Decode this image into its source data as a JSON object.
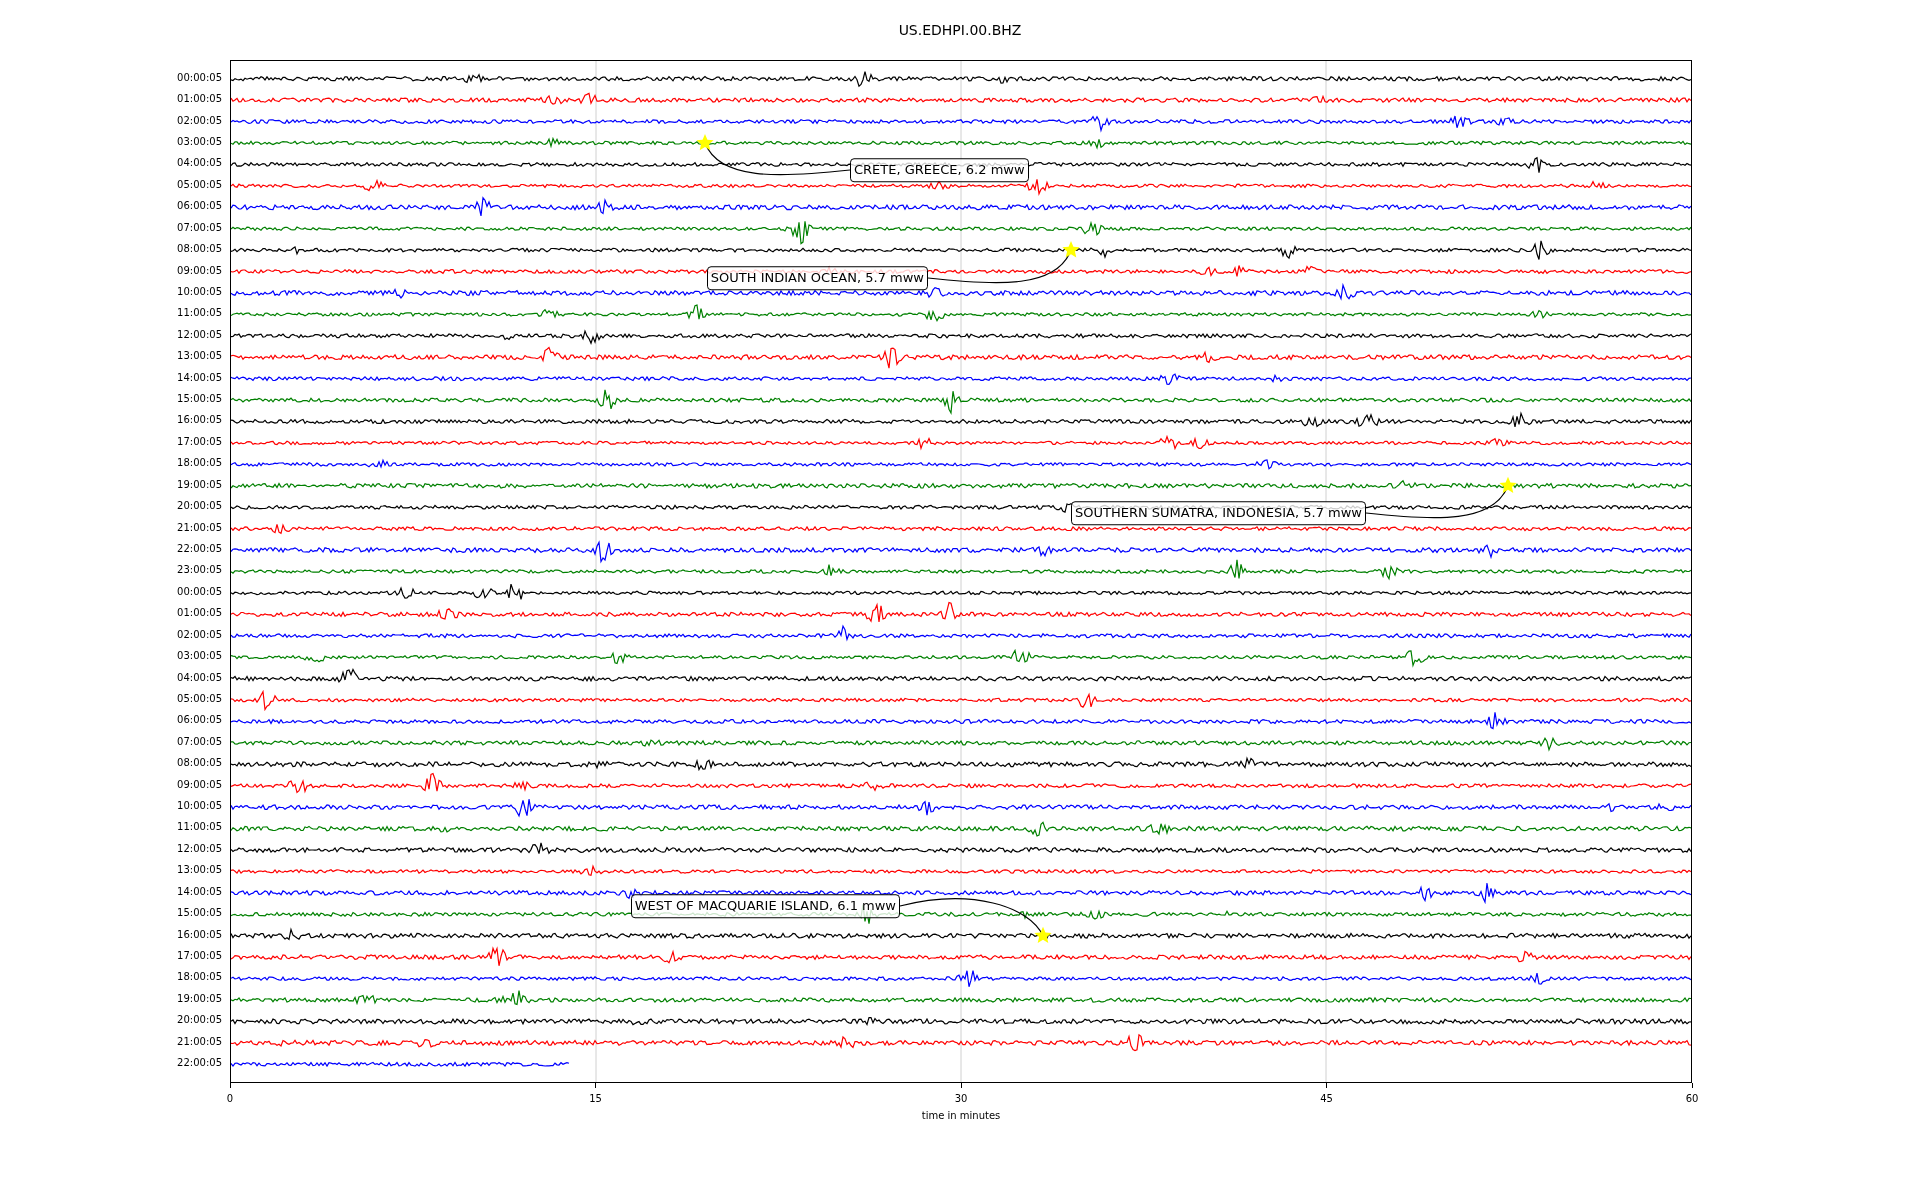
{
  "title": "US.EDHPI.00.BHZ",
  "rows": [
    {
      "label": "00:00:05",
      "color": "#000000"
    },
    {
      "label": "01:00:05",
      "color": "#ff0000"
    },
    {
      "label": "02:00:05",
      "color": "#0000ff"
    },
    {
      "label": "03:00:05",
      "color": "#008000"
    },
    {
      "label": "04:00:05",
      "color": "#000000"
    },
    {
      "label": "05:00:05",
      "color": "#ff0000"
    },
    {
      "label": "06:00:05",
      "color": "#0000ff"
    },
    {
      "label": "07:00:05",
      "color": "#008000"
    },
    {
      "label": "08:00:05",
      "color": "#000000"
    },
    {
      "label": "09:00:05",
      "color": "#ff0000"
    },
    {
      "label": "10:00:05",
      "color": "#0000ff"
    },
    {
      "label": "11:00:05",
      "color": "#008000"
    },
    {
      "label": "12:00:05",
      "color": "#000000"
    },
    {
      "label": "13:00:05",
      "color": "#ff0000"
    },
    {
      "label": "14:00:05",
      "color": "#0000ff"
    },
    {
      "label": "15:00:05",
      "color": "#008000"
    },
    {
      "label": "16:00:05",
      "color": "#000000"
    },
    {
      "label": "17:00:05",
      "color": "#ff0000"
    },
    {
      "label": "18:00:05",
      "color": "#0000ff"
    },
    {
      "label": "19:00:05",
      "color": "#008000"
    },
    {
      "label": "20:00:05",
      "color": "#000000"
    },
    {
      "label": "21:00:05",
      "color": "#ff0000"
    },
    {
      "label": "22:00:05",
      "color": "#0000ff"
    },
    {
      "label": "23:00:05",
      "color": "#008000"
    },
    {
      "label": "00:00:05",
      "color": "#000000"
    },
    {
      "label": "01:00:05",
      "color": "#ff0000"
    },
    {
      "label": "02:00:05",
      "color": "#0000ff"
    },
    {
      "label": "03:00:05",
      "color": "#008000"
    },
    {
      "label": "04:00:05",
      "color": "#000000"
    },
    {
      "label": "05:00:05",
      "color": "#ff0000"
    },
    {
      "label": "06:00:05",
      "color": "#0000ff"
    },
    {
      "label": "07:00:05",
      "color": "#008000"
    },
    {
      "label": "08:00:05",
      "color": "#000000"
    },
    {
      "label": "09:00:05",
      "color": "#ff0000"
    },
    {
      "label": "10:00:05",
      "color": "#0000ff"
    },
    {
      "label": "11:00:05",
      "color": "#008000"
    },
    {
      "label": "12:00:05",
      "color": "#000000"
    },
    {
      "label": "13:00:05",
      "color": "#ff0000"
    },
    {
      "label": "14:00:05",
      "color": "#0000ff"
    },
    {
      "label": "15:00:05",
      "color": "#008000"
    },
    {
      "label": "16:00:05",
      "color": "#000000"
    },
    {
      "label": "17:00:05",
      "color": "#ff0000"
    },
    {
      "label": "18:00:05",
      "color": "#0000ff"
    },
    {
      "label": "19:00:05",
      "color": "#008000"
    },
    {
      "label": "20:00:05",
      "color": "#000000"
    },
    {
      "label": "21:00:05",
      "color": "#ff0000"
    },
    {
      "label": "22:00:05",
      "color": "#0000ff"
    }
  ],
  "events": [
    {
      "label": "CRETE, GREECE, 6.2 mww"
    },
    {
      "label": "SOUTH INDIAN OCEAN, 5.7 mww"
    },
    {
      "label": "SOUTHERN SUMATRA, INDONESIA, 5.7 mww"
    },
    {
      "label": "WEST OF MACQUARIE ISLAND, 6.1 mww"
    }
  ],
  "x_ticks": [
    "0",
    "15",
    "30",
    "45",
    "60"
  ],
  "xlabel": "time in minutes"
}
